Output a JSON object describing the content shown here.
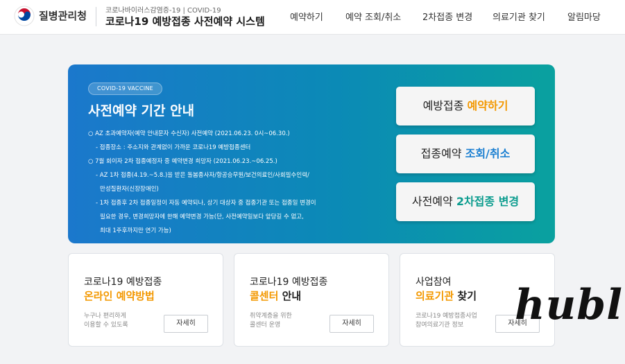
{
  "header": {
    "org_name": "질병관리청",
    "subtitle": "코로나바이러스감염증-19 | COVID-19",
    "system_title": "코로나19 예방접종 사전예약 시스템",
    "nav": [
      "예약하기",
      "예약 조회/취소",
      "2차접종 변경",
      "의료기관 찾기",
      "알림마당"
    ]
  },
  "banner": {
    "chip": "COVID-19 VACCINE",
    "title": "사전예약 기간 안내",
    "lines": [
      "○  AZ 초과예약자(예약 안내문자 수신자) 사전예약 (2021.06.23. 0시~06.30.)",
      "- 접종장소 : 주소지와 관계없이 가까운 코로나19 예방접종센터",
      "○  7월 회이자 2차 접종예정자 중 예약변경 희망자 (2021.06.23.~06.25.)",
      "- AZ 1차 접종(4.19.~5.8.)을 받은 돌봄종사자/항공승무원/보건의료인/사회필수인력/",
      "만성질환자(신장장애인)",
      "- 1차 접종후 2차 접종일정이 자동 예약되나, 상기 대상자 중 접종기관 또는 접종일 변경이",
      "필요한 경우, 변경희망자에 한해 예약변경 가능(단, 사전예약일보다 앞당길 수 없고,",
      "최대 1주후까지만 연기 가능)"
    ],
    "cta1": {
      "prefix": "예방접종 ",
      "highlight": "예약하기"
    },
    "cta2": {
      "prefix": "접종예약 ",
      "highlight": "조회/취소"
    },
    "cta3": {
      "prefix": "사전예약 ",
      "highlight": "2차접종 변경"
    }
  },
  "cards": [
    {
      "t1": "코로나19 예방접종",
      "t2_hl": "온라인 예약방법",
      "t2_rest": "",
      "d1": "누구나 편리하게",
      "d2": "이용할 수 있도록",
      "more": "자세히"
    },
    {
      "t1": "코로나19 예방접종",
      "t2_hl": "콜센터",
      "t2_rest": " 안내",
      "d1": "취약계층을 위한",
      "d2": "콜센터 운영",
      "more": "자세히"
    },
    {
      "t1": "사업참여",
      "t2_hl": "의료기관",
      "t2_rest": " 찾기",
      "d1": "코로나19 예방접종사업",
      "d2": "참여의료기관 정보",
      "more": "자세히"
    }
  ],
  "watermark": "hubl",
  "colors": {
    "orange": "#f39800",
    "blue": "#1b7fd1",
    "teal": "#0b9c8e",
    "banner_start": "#1b78cc",
    "banner_end": "#0aa19f"
  },
  "icons": {
    "logo": "taegeuk-logo-icon"
  }
}
